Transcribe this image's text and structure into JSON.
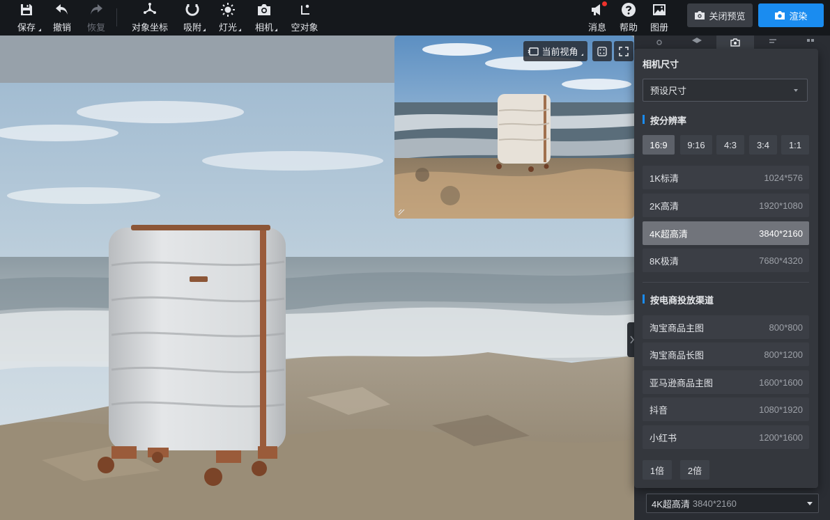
{
  "toolbar": {
    "save": "保存",
    "undo": "撤销",
    "redo": "恢复",
    "object_coords": "对象坐标",
    "snap": "吸附",
    "lighting": "灯光",
    "camera": "相机",
    "empty_object": "空对象",
    "messages": "消息",
    "help": "帮助",
    "album": "图册",
    "close_preview": "关闭预览",
    "render": "渲染"
  },
  "preview_window": {
    "current_view": "当前视角"
  },
  "camera_panel": {
    "title": "相机尺寸",
    "preset_placeholder": "预设尺寸",
    "by_resolution": "按分辨率",
    "ratios": [
      {
        "label": "16:9",
        "active": true
      },
      {
        "label": "9:16",
        "active": false
      },
      {
        "label": "4:3",
        "active": false
      },
      {
        "label": "3:4",
        "active": false
      },
      {
        "label": "1:1",
        "active": false
      }
    ],
    "resolutions": [
      {
        "name": "1K标清",
        "size": "1024*576",
        "active": false
      },
      {
        "name": "2K高清",
        "size": "1920*1080",
        "active": false
      },
      {
        "name": "4K超高清",
        "size": "3840*2160",
        "active": true
      },
      {
        "name": "8K极清",
        "size": "7680*4320",
        "active": false
      }
    ],
    "by_channel": "按电商投放渠道",
    "channels": [
      {
        "name": "淘宝商品主图",
        "size": "800*800"
      },
      {
        "name": "淘宝商品长图",
        "size": "800*1200"
      },
      {
        "name": "亚马逊商品主图",
        "size": "1600*1600"
      },
      {
        "name": "抖音",
        "size": "1080*1920"
      },
      {
        "name": "小红书",
        "size": "1200*1600"
      }
    ],
    "multipliers": [
      "1倍",
      "2倍"
    ]
  },
  "bottom_select": {
    "label": "4K超高清",
    "size": "3840*2160"
  },
  "colors": {
    "toolbar_bg": "#15181c",
    "accent": "#1a8cf0",
    "panel_bg": "#34373d",
    "notification_dot": "#f0322c"
  }
}
